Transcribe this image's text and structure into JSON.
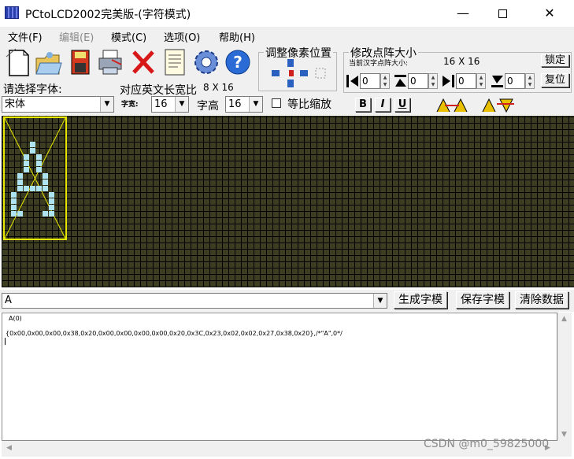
{
  "window": {
    "title": "PCtoLCD2002完美版-(字符模式)",
    "min": "—",
    "close": "✕"
  },
  "menu": [
    {
      "label": "文件(F)",
      "enabled": true
    },
    {
      "label": "编辑(E)",
      "enabled": false
    },
    {
      "label": "模式(C)",
      "enabled": true
    },
    {
      "label": "选项(O)",
      "enabled": true
    },
    {
      "label": "帮助(H)",
      "enabled": true
    }
  ],
  "toolbar_icons": [
    "new-file-icon",
    "open-folder-icon",
    "save-disk-icon",
    "print-icon",
    "delete-icon",
    "document-icon",
    "settings-gear-icon",
    "help-icon"
  ],
  "pixel_adjust": {
    "title": "调整像素位置"
  },
  "dot_matrix": {
    "title": "修改点阵大小",
    "current_size_label": "当前汉字点阵大小:",
    "current_size": "16 X 16",
    "lock_label": "锁定",
    "restore_label": "复位",
    "spinners": [
      "0",
      "0",
      "0",
      "0"
    ]
  },
  "font": {
    "select_label": "请选择字体:",
    "ratio_label": "对应英文长宽比",
    "ratio_value": "8 X 16",
    "selected_font": "宋体",
    "width_label": "字宽:",
    "width_value": "16",
    "height_label": "字高",
    "height_value": "16",
    "scale_label": "等比缩放",
    "bold": "B",
    "italic": "I",
    "underline": "U"
  },
  "input": {
    "text": "A",
    "generate_label": "生成字模",
    "save_label": "保存字模",
    "clear_label": "清除数据"
  },
  "output": {
    "line1": "A(0)",
    "line2": "{0x00,0x00,0x00,0x38,0x20,0x00,0x00,0x00,0x00,0x20,0x3C,0x23,0x02,0x02,0x27,0x38,0x20},/*\"A\",0*/"
  },
  "watermark": "CSDN @m0_59825000",
  "colors": {
    "lit_pixel": "#aee3f2",
    "grid_cell": "#3d3d21",
    "char_frame": "#e8e800"
  }
}
